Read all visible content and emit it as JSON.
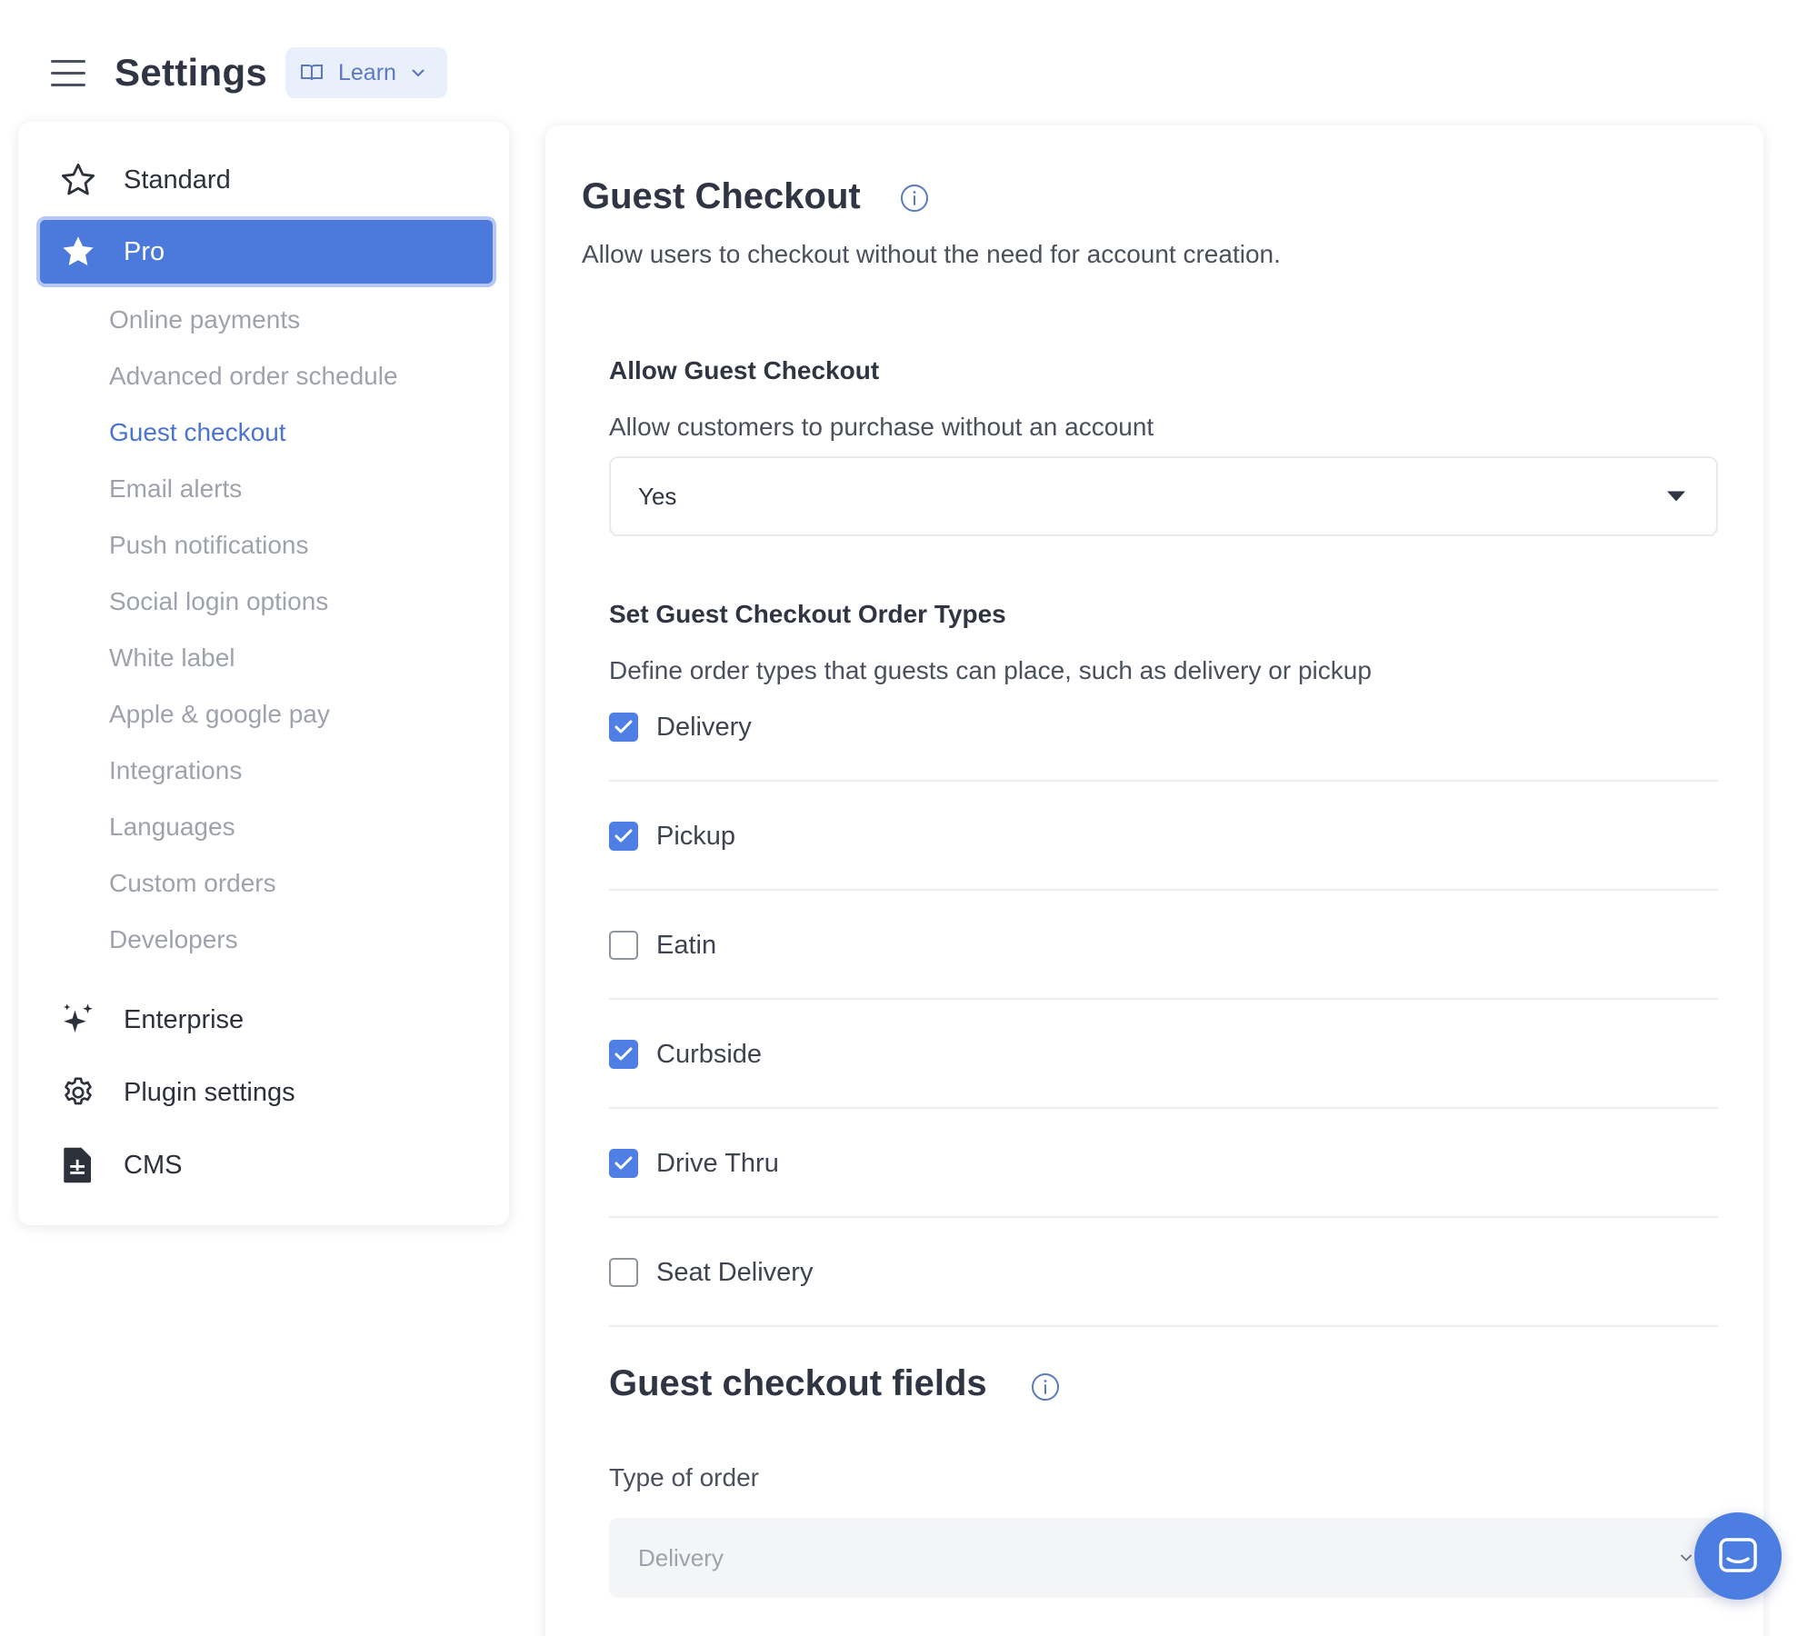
{
  "header": {
    "title": "Settings",
    "learn_label": "Learn"
  },
  "sidebar": {
    "main_items": [
      {
        "label": "Standard",
        "icon": "star-outline-icon"
      },
      {
        "label": "Pro",
        "icon": "star-filled-icon",
        "active": true
      },
      {
        "label": "Enterprise",
        "icon": "sparkles-icon"
      },
      {
        "label": "Plugin settings",
        "icon": "gear-icon"
      },
      {
        "label": "CMS",
        "icon": "document-icon"
      }
    ],
    "sub_items": [
      {
        "label": "Online payments"
      },
      {
        "label": "Advanced order schedule"
      },
      {
        "label": "Guest checkout",
        "active": true
      },
      {
        "label": "Email alerts"
      },
      {
        "label": "Push notifications"
      },
      {
        "label": "Social login options"
      },
      {
        "label": "White label"
      },
      {
        "label": "Apple & google pay"
      },
      {
        "label": "Integrations"
      },
      {
        "label": "Languages"
      },
      {
        "label": "Custom orders"
      },
      {
        "label": "Developers"
      }
    ]
  },
  "main": {
    "title": "Guest Checkout",
    "description": "Allow users to checkout without the need for account creation.",
    "allow_guest": {
      "label": "Allow Guest Checkout",
      "description": "Allow customers to purchase without an account",
      "selected": "Yes"
    },
    "order_types": {
      "label": "Set Guest Checkout Order Types",
      "description": "Define order types that guests can place, such as delivery or pickup",
      "options": [
        {
          "label": "Delivery",
          "checked": true
        },
        {
          "label": "Pickup",
          "checked": true
        },
        {
          "label": "Eatin",
          "checked": false
        },
        {
          "label": "Curbside",
          "checked": true
        },
        {
          "label": "Drive Thru",
          "checked": true
        },
        {
          "label": "Seat Delivery",
          "checked": false
        }
      ]
    },
    "fields_section": {
      "title": "Guest checkout fields",
      "type_label": "Type of order",
      "type_selected": "Delivery"
    }
  },
  "colors": {
    "accent": "#4c79dc",
    "active_link": "#4a74cf",
    "muted_text": "#9ea3ab"
  }
}
